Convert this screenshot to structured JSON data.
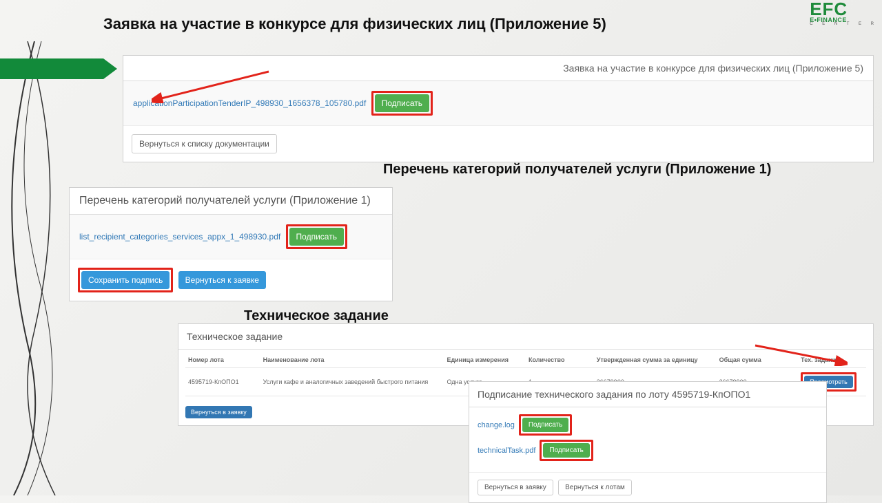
{
  "logo": {
    "top": "EFC",
    "mid": "E•FINANCE",
    "bot": "C E N T E R"
  },
  "title_main": "Заявка на участие в конкурсе для физических лиц (Приложение 5)",
  "subtitle2": "Перечень категорий получателей услуги (Приложение 1)",
  "subtitle3": "Техническое задание",
  "p1": {
    "header": "Заявка на участие в конкурсе для физических лиц (Приложение 5)",
    "file": "applicationParticipationTenderIP_498930_1656378_105780.pdf",
    "sign": "Подписать",
    "back": "Вернуться к списку документации"
  },
  "p2": {
    "header": "Перечень категорий получателей услуги (Приложение 1)",
    "file": "list_recipient_categories_services_appx_1_498930.pdf",
    "sign": "Подписать",
    "save": "Сохранить подпись",
    "back": "Вернуться к заявке"
  },
  "p3": {
    "header": "Техническое задание",
    "cols": {
      "lot_no": "Номер лота",
      "lot_name": "Наименование лота",
      "unit": "Единица измерения",
      "qty": "Количество",
      "price": "Утвержденная сумма за единицу",
      "total": "Общая сумма",
      "task": "Тех. задание"
    },
    "row": {
      "lot_no": "4595719-КпОПО1",
      "lot_name": "Услуги кафе и аналогичных заведений быстрого питания",
      "unit": "Одна услуга",
      "qty": "1",
      "price": "36679900",
      "total": "36679900",
      "view": "Просмотреть"
    },
    "back": "Вернуться в заявку"
  },
  "p4": {
    "header": "Подписание технического задания по лоту 4595719-КпОПО1",
    "file1": "change.log",
    "file2": "technicalTask.pdf",
    "sign": "Подписать",
    "back1": "Вернуться в заявку",
    "back2": "Вернуться к лотам"
  }
}
